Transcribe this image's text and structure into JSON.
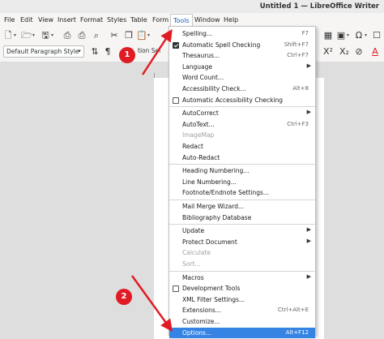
{
  "window": {
    "title": "Untitled 1 — LibreOffice Writer"
  },
  "menubar": [
    "File",
    "Edit",
    "View",
    "Insert",
    "Format",
    "Styles",
    "Table",
    "Form",
    "Tools",
    "Window",
    "Help"
  ],
  "toolbar": {
    "paragraph_style": "Default Paragraph Style",
    "fragment_text": "tion Sel",
    "right_icons": [
      "X²",
      "X₂",
      "Ω",
      "A"
    ]
  },
  "tools_menu": {
    "items": [
      {
        "label": "Spelling...",
        "shortcut": "F7"
      },
      {
        "label": "Automatic Spell Checking",
        "shortcut": "Shift+F7",
        "checkbox": "checked"
      },
      {
        "label": "Thesaurus...",
        "shortcut": "Ctrl+F7"
      },
      {
        "label": "Language",
        "submenu": true
      },
      {
        "label": "Word Count..."
      },
      {
        "label": "Accessibility Check...",
        "shortcut": "Alt+8"
      },
      {
        "label": "Automatic Accessibility Checking",
        "checkbox": "unchecked"
      },
      {
        "sep": true
      },
      {
        "label": "AutoCorrect",
        "submenu": true
      },
      {
        "label": "AutoText...",
        "shortcut": "Ctrl+F3"
      },
      {
        "label": "ImageMap",
        "disabled": true
      },
      {
        "label": "Redact"
      },
      {
        "label": "Auto-Redact"
      },
      {
        "sep": true
      },
      {
        "label": "Heading Numbering..."
      },
      {
        "label": "Line Numbering..."
      },
      {
        "label": "Footnote/Endnote Settings..."
      },
      {
        "sep": true
      },
      {
        "label": "Mail Merge Wizard..."
      },
      {
        "label": "Bibliography Database"
      },
      {
        "sep": true
      },
      {
        "label": "Update",
        "submenu": true
      },
      {
        "label": "Protect Document",
        "submenu": true
      },
      {
        "label": "Calculate",
        "disabled": true
      },
      {
        "label": "Sort...",
        "disabled": true
      },
      {
        "sep": true
      },
      {
        "label": "Macros",
        "submenu": true
      },
      {
        "label": "Development Tools",
        "checkbox": "unchecked"
      },
      {
        "label": "XML Filter Settings..."
      },
      {
        "label": "Extensions...",
        "shortcut": "Ctrl+Alt+E"
      },
      {
        "label": "Customize..."
      },
      {
        "label": "Options...",
        "shortcut": "Alt+F12",
        "highlight": true
      }
    ]
  },
  "annotations": {
    "badge1": "1",
    "badge2": "2",
    "color": "#e01b24"
  },
  "colors": {
    "highlight": "#3584e4",
    "active_menu_text": "#1a5fb4"
  }
}
